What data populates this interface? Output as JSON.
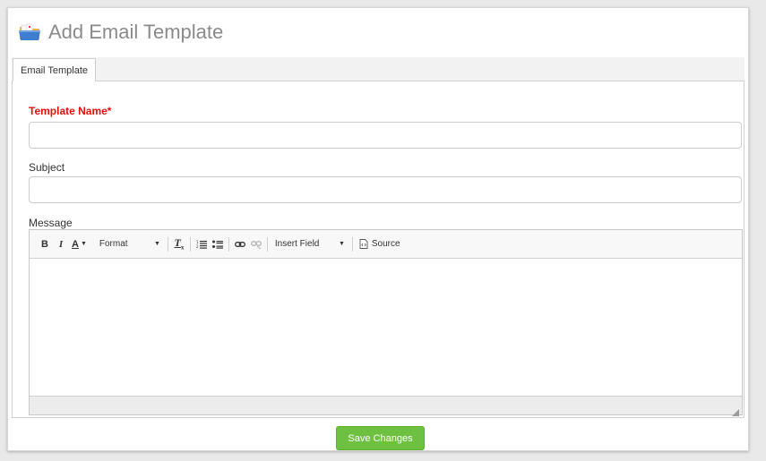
{
  "header": {
    "title": "Add Email Template",
    "icon": "folder-icon"
  },
  "tabs": [
    {
      "label": "Email Template",
      "active": true
    }
  ],
  "form": {
    "template_name": {
      "label": "Template Name*",
      "value": "",
      "required": true,
      "label_color": "#e1100c"
    },
    "subject": {
      "label": "Subject",
      "value": ""
    },
    "message": {
      "label": "Message",
      "value": ""
    }
  },
  "editor_toolbar": {
    "bold": "B",
    "italic": "I",
    "text_color": "A",
    "format_label": "Format",
    "remove_format": "Tx",
    "insert_field_label": "Insert Field",
    "source_label": "Source"
  },
  "actions": {
    "save_label": "Save Changes",
    "save_color": "#6ec040"
  }
}
